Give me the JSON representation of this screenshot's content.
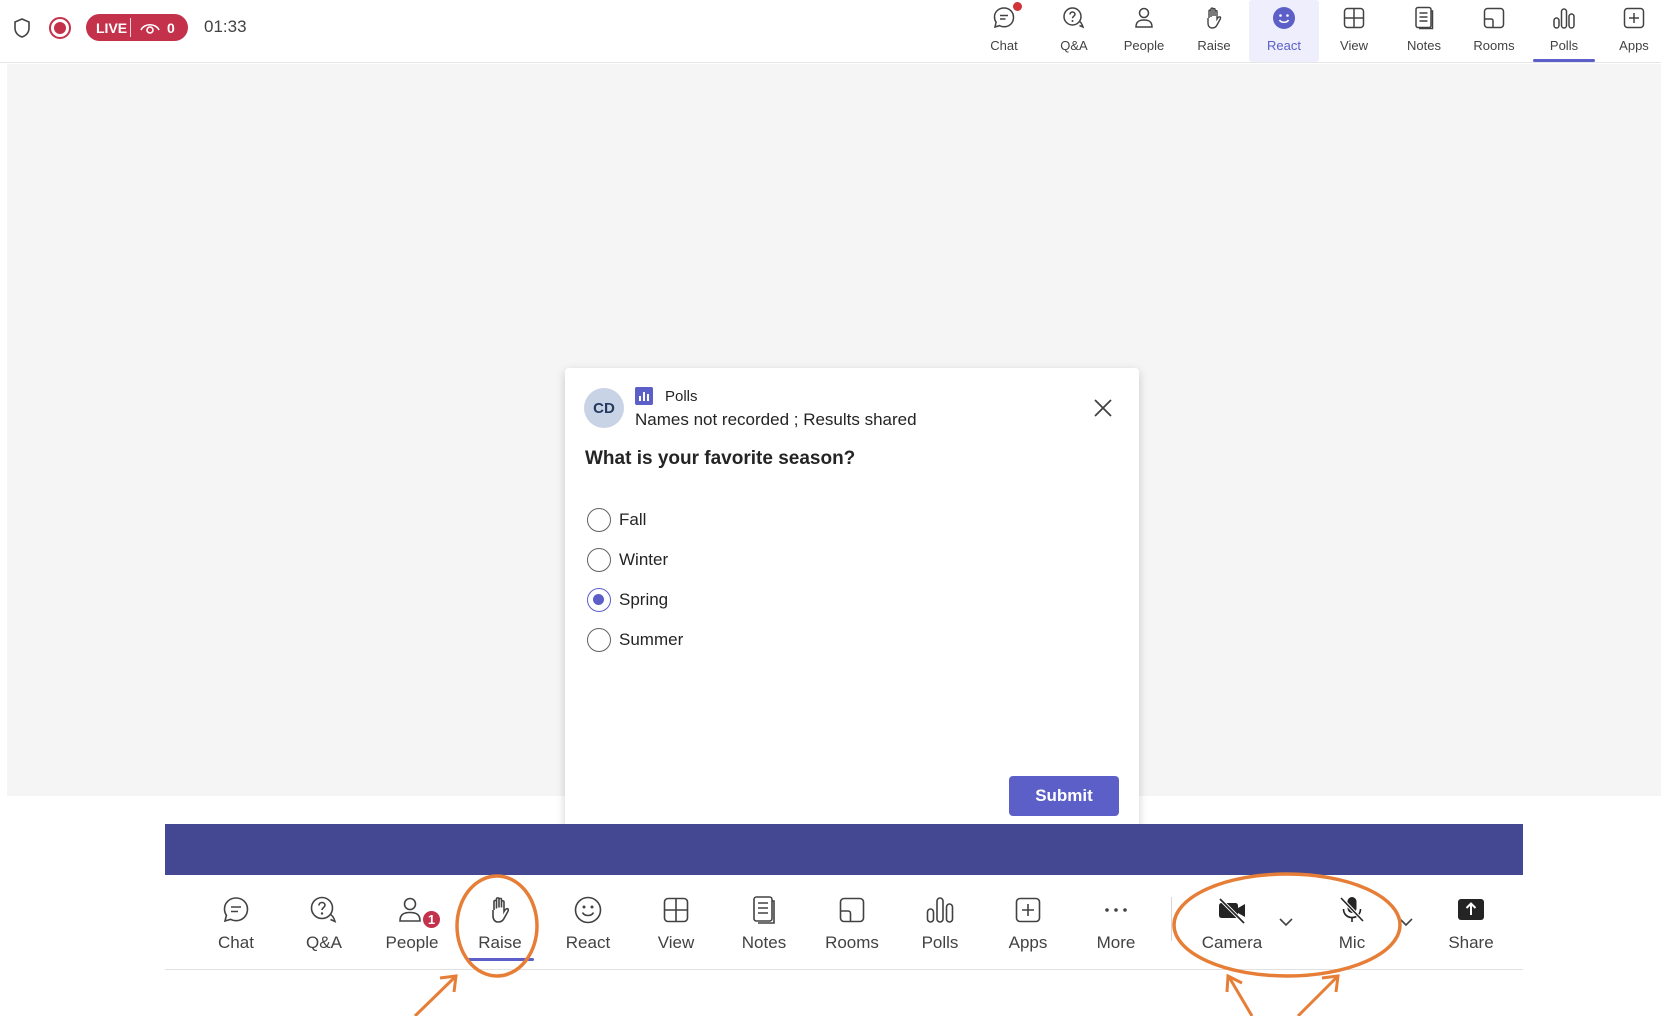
{
  "topbar": {
    "live_label": "LIVE",
    "viewer_count": "0",
    "timer": "01:33",
    "tabs": [
      {
        "label": "Chat"
      },
      {
        "label": "Q&A"
      },
      {
        "label": "People"
      },
      {
        "label": "Raise"
      },
      {
        "label": "React"
      },
      {
        "label": "View"
      },
      {
        "label": "Notes"
      },
      {
        "label": "Rooms"
      },
      {
        "label": "Polls"
      },
      {
        "label": "Apps"
      }
    ]
  },
  "poll": {
    "avatar_initials": "CD",
    "app_name": "Polls",
    "meta": "Names not recorded ; Results shared",
    "question": "What is your favorite season?",
    "options": [
      {
        "label": "Fall",
        "selected": false
      },
      {
        "label": "Winter",
        "selected": false
      },
      {
        "label": "Spring",
        "selected": true
      },
      {
        "label": "Summer",
        "selected": false
      }
    ],
    "submit_label": "Submit"
  },
  "toolbar": {
    "items": [
      {
        "label": "Chat"
      },
      {
        "label": "Q&A"
      },
      {
        "label": "People",
        "badge": "1"
      },
      {
        "label": "Raise"
      },
      {
        "label": "React"
      },
      {
        "label": "View"
      },
      {
        "label": "Notes"
      },
      {
        "label": "Rooms"
      },
      {
        "label": "Polls"
      },
      {
        "label": "Apps"
      },
      {
        "label": "More"
      },
      {
        "label": "Camera"
      },
      {
        "label": "Mic"
      },
      {
        "label": "Share"
      }
    ]
  },
  "colors": {
    "accent": "#5b5fc7",
    "live_red": "#c4314b",
    "banner": "#444791",
    "annotation_orange": "#e67e37"
  }
}
